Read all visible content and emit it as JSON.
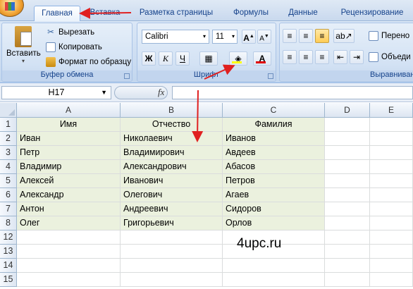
{
  "tabs": [
    "Главная",
    "Вставка",
    "Разметка страницы",
    "Формулы",
    "Данные",
    "Рецензирование"
  ],
  "clipboard": {
    "paste": "Вставить",
    "cut": "Вырезать",
    "copy": "Копировать",
    "format_painter": "Формат по образцу",
    "label": "Буфер обмена"
  },
  "font": {
    "name": "Calibri",
    "size": "11",
    "bold": "Ж",
    "italic": "К",
    "underline": "Ч",
    "label": "Шрифт"
  },
  "alignment": {
    "wrap": "Перено",
    "merge": "Объеди",
    "label": "Выравнивани"
  },
  "formula_bar": {
    "name_box": "H17",
    "fx": "fx",
    "value": ""
  },
  "columns": [
    "A",
    "B",
    "C",
    "D",
    "E"
  ],
  "rows": [
    {
      "num": "1",
      "a": "Имя",
      "b": "Отчество",
      "c": "Фамилия"
    },
    {
      "num": "2",
      "a": "Иван",
      "b": "Николаевич",
      "c": "Иванов"
    },
    {
      "num": "3",
      "a": "Петр",
      "b": "Владимирович",
      "c": "Авдеев"
    },
    {
      "num": "4",
      "a": "Владимир",
      "b": "Александрович",
      "c": "Абасов"
    },
    {
      "num": "5",
      "a": "Алексей",
      "b": "Иванович",
      "c": "Петров"
    },
    {
      "num": "6",
      "a": "Александр",
      "b": "Олегович",
      "c": "Агаев"
    },
    {
      "num": "7",
      "a": "Антон",
      "b": "Андреевич",
      "c": "Сидоров"
    },
    {
      "num": "8",
      "a": "Олег",
      "b": "Григорьевич",
      "c": "Орлов"
    },
    {
      "num": "12",
      "a": "",
      "b": "",
      "c": ""
    },
    {
      "num": "13",
      "a": "",
      "b": "",
      "c": ""
    },
    {
      "num": "14",
      "a": "",
      "b": "",
      "c": ""
    },
    {
      "num": "15",
      "a": "",
      "b": "",
      "c": ""
    }
  ],
  "watermark": "4upc.ru",
  "colors": {
    "fill": "#ebf1de",
    "arrow": "#e02020"
  }
}
